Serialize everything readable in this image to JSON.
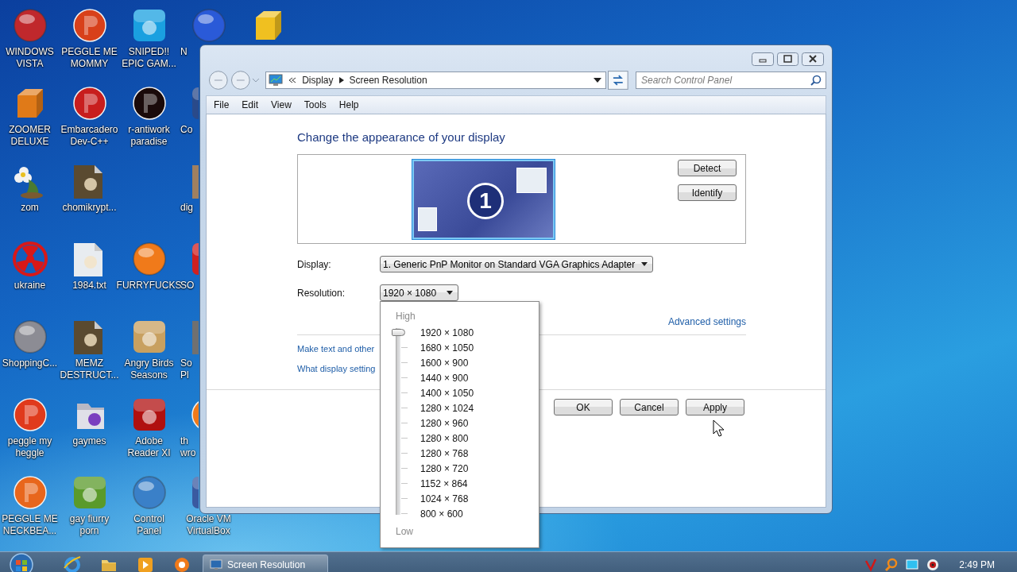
{
  "desktop": {
    "columns": [
      [
        {
          "label": [
            "WINDOWS",
            "VISTA"
          ],
          "kind": "orb",
          "color": "#c0282c"
        },
        {
          "label": [
            "ZOOMER",
            "DELUXE"
          ],
          "kind": "block",
          "color": "#e07a18"
        },
        {
          "label": [
            "zom"
          ],
          "kind": "flower",
          "color": "#f2f2f2"
        },
        {
          "label": [
            "ukraine"
          ],
          "kind": "hazard",
          "color": "#d81818"
        },
        {
          "label": [
            "ShoppingC..."
          ],
          "kind": "orb",
          "color": "#8c8c94"
        },
        {
          "label": [
            "peggle my",
            "heggle"
          ],
          "kind": "disc",
          "color": "#e03a1c"
        },
        {
          "label": [
            "PEGGLE ME",
            "NECKBEA..."
          ],
          "kind": "disc",
          "color": "#e8661c"
        }
      ],
      [
        {
          "label": [
            "PEGGLE ME",
            "MOMMY"
          ],
          "kind": "disc",
          "color": "#d8401a"
        },
        {
          "label": [
            "Embarcadero",
            "Dev-C++"
          ],
          "kind": "disc",
          "color": "#c81e1e"
        },
        {
          "label": [
            "chomikrypt..."
          ],
          "kind": "doc",
          "color": "#5a4a30"
        },
        {
          "label": [
            "1984.txt"
          ],
          "kind": "doc",
          "color": "#e8ecf0"
        },
        {
          "label": [
            "MEMZ",
            "DESTRUCT..."
          ],
          "kind": "doc",
          "color": "#5a4a30"
        },
        {
          "label": [
            "gaymes"
          ],
          "kind": "folder",
          "color": "#e0e0e8"
        },
        {
          "label": [
            "gay fiurry",
            "porn"
          ],
          "kind": "tile",
          "color": "#5a9a2a"
        }
      ],
      [
        {
          "label": [
            "SNIPED!!",
            "EPIC GAM..."
          ],
          "kind": "tile",
          "color": "#1aa0e0"
        },
        {
          "label": [
            "r-antiwork",
            "paradise"
          ],
          "kind": "disc",
          "color": "#1a0a0a"
        },
        null,
        {
          "label": [
            "FURRYFUCKS"
          ],
          "kind": "orb",
          "color": "#f07a1a"
        },
        {
          "label": [
            "Angry Birds",
            "Seasons"
          ],
          "kind": "tile",
          "color": "#c8a060"
        },
        {
          "label": [
            "Adobe",
            "Reader XI"
          ],
          "kind": "tile",
          "color": "#b01010"
        },
        {
          "label": [
            "Control",
            "Panel"
          ],
          "kind": "orb",
          "color": "#3a80c8"
        }
      ],
      [
        {
          "label": [
            "N"
          ],
          "kind": "orb",
          "color": "#2a5ad8",
          "cut_off": true
        },
        {
          "label": [
            "Co"
          ],
          "kind": "tile",
          "color": "#2a4a8a",
          "cut_off": true
        },
        {
          "label": [
            "dig"
          ],
          "kind": "doc",
          "color": "#a08060",
          "cut_off": true
        },
        {
          "label": [
            "SO"
          ],
          "kind": "tile",
          "color": "#d02020",
          "cut_off": true
        },
        {
          "label": [
            "So",
            "Pl"
          ],
          "kind": "doc",
          "color": "#707070",
          "cut_off": true
        },
        {
          "label": [
            "th",
            "wro"
          ],
          "kind": "disc",
          "color": "#f07a1a",
          "cut_off": true
        },
        {
          "label": [
            "Oracle VM",
            "VirtualBox"
          ],
          "kind": "tile",
          "color": "#3a5aa0"
        }
      ],
      [
        {
          "kind": "block",
          "color": "#f0c020"
        }
      ]
    ]
  },
  "window": {
    "address": {
      "breadcrumbs": [
        "Display",
        "Screen Resolution"
      ]
    },
    "search": {
      "placeholder": "Search Control Panel"
    },
    "menu": [
      "File",
      "Edit",
      "View",
      "Tools",
      "Help"
    ],
    "heading": "Change the appearance of your display",
    "monitor": {
      "number": "1",
      "selected": true
    },
    "side_buttons": [
      "Detect",
      "Identify"
    ],
    "fields": [
      {
        "label": "Display:",
        "value": "1. Generic PnP Monitor on Standard VGA Graphics Adapter",
        "expanded": false
      },
      {
        "label": "Resolution:",
        "value": "1920 × 1080",
        "expanded": true
      }
    ],
    "advanced_link": "Advanced settings",
    "links": [
      "Make text and other",
      "What display setting"
    ],
    "buttons": [
      "OK",
      "Cancel",
      "Apply"
    ]
  },
  "resolution_menu": {
    "high_label": "High",
    "low_label": "Low",
    "options": [
      {
        "label": "1920 × 1080",
        "selected": true
      },
      {
        "label": "1680 × 1050",
        "selected": false
      },
      {
        "label": "1600 × 900",
        "selected": false
      },
      {
        "label": "1440 × 900",
        "selected": false
      },
      {
        "label": "1400 × 1050",
        "selected": false
      },
      {
        "label": "1280 × 1024",
        "selected": false
      },
      {
        "label": "1280 × 960",
        "selected": false
      },
      {
        "label": "1280 × 800",
        "selected": false
      },
      {
        "label": "1280 × 768",
        "selected": false
      },
      {
        "label": "1280 × 720",
        "selected": false
      },
      {
        "label": "1152 × 864",
        "selected": false
      },
      {
        "label": "1024 × 768",
        "selected": false
      },
      {
        "label": "800 × 600",
        "selected": false
      }
    ]
  },
  "taskbar": {
    "tasks": [
      {
        "label": "Screen Resolution",
        "active": true
      }
    ],
    "clock": "2:49 PM"
  }
}
